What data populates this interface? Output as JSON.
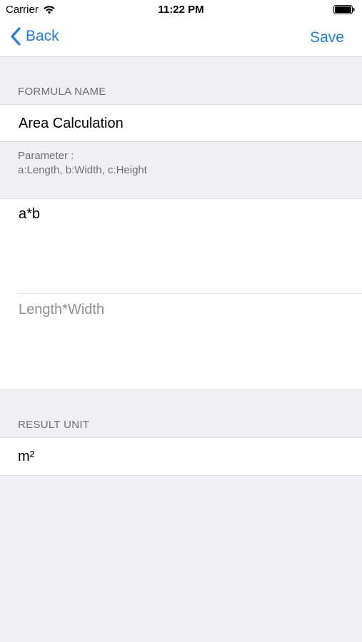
{
  "status_bar": {
    "carrier": "Carrier",
    "time": "11:22 PM"
  },
  "nav": {
    "back_label": "Back",
    "save_label": "Save"
  },
  "formula_name": {
    "header": "FORMULA NAME",
    "value": "Area Calculation"
  },
  "parameters": {
    "title": "Parameter :",
    "list": "a:Length, b:Width, c:Height"
  },
  "formula": {
    "expression": "a*b",
    "description": "Length*Width"
  },
  "result_unit": {
    "header": "RESULT UNIT",
    "value": "m²"
  },
  "colors": {
    "accent": "#1A7CF5",
    "background": "#EFEFF4",
    "secondary_text": "#6D6D72",
    "placeholder_text": "#8E8E93"
  }
}
